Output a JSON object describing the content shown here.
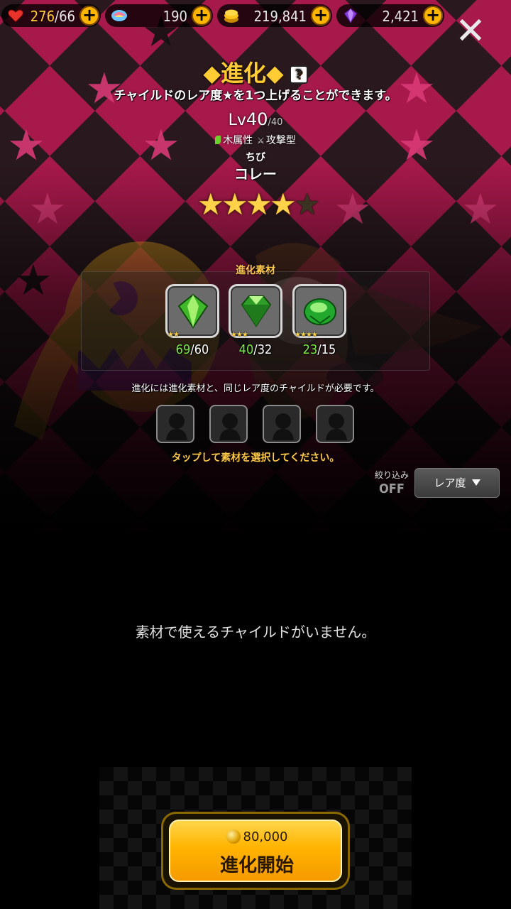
{
  "resources": {
    "stamina": {
      "current": "276",
      "max": "/66",
      "icon": "heart-icon"
    },
    "gems": {
      "value": "190",
      "icon": "rainbow-gem-icon"
    },
    "gold": {
      "value": "219,841",
      "icon": "gold-coin-icon"
    },
    "crystals": {
      "value": "2,421",
      "icon": "purple-crystal-icon"
    }
  },
  "header": {
    "title": "◆進化◆",
    "help_label": "?",
    "subtitle": "チャイルドのレア度★を1つ上げることができます。"
  },
  "character": {
    "level_prefix": "Lv",
    "level": "40",
    "level_max": "/40",
    "attribute": "木属性",
    "type": "攻撃型",
    "name_ruby": "ちび",
    "name": "コレー",
    "rarity": 4,
    "rarity_max": 5
  },
  "materials": {
    "label": "進化素材",
    "items": [
      {
        "stars": "★★",
        "have": "69",
        "need": "/60",
        "icon": "green-gem-2star-icon"
      },
      {
        "stars": "★★★",
        "have": "40",
        "need": "/32",
        "icon": "green-gem-3star-icon"
      },
      {
        "stars": "★★★★",
        "have": "23",
        "need": "/15",
        "icon": "green-gem-4star-icon"
      }
    ]
  },
  "requirement_note": "進化には進化素材と、同じレア度のチャイルドが必要です。",
  "tap_note": "タップして素材を選択してください。",
  "filter": {
    "label": "絞り込み",
    "state": "OFF",
    "sort_label": "レア度"
  },
  "empty_message": "素材で使えるチャイルドがいません。",
  "start": {
    "cost": "80,000",
    "label": "進化開始"
  },
  "colors": {
    "accent": "#ffcc33",
    "gold_button": "#ffb300",
    "have_ok": "#7bea4a",
    "bg_pink": "#b01a4e"
  }
}
